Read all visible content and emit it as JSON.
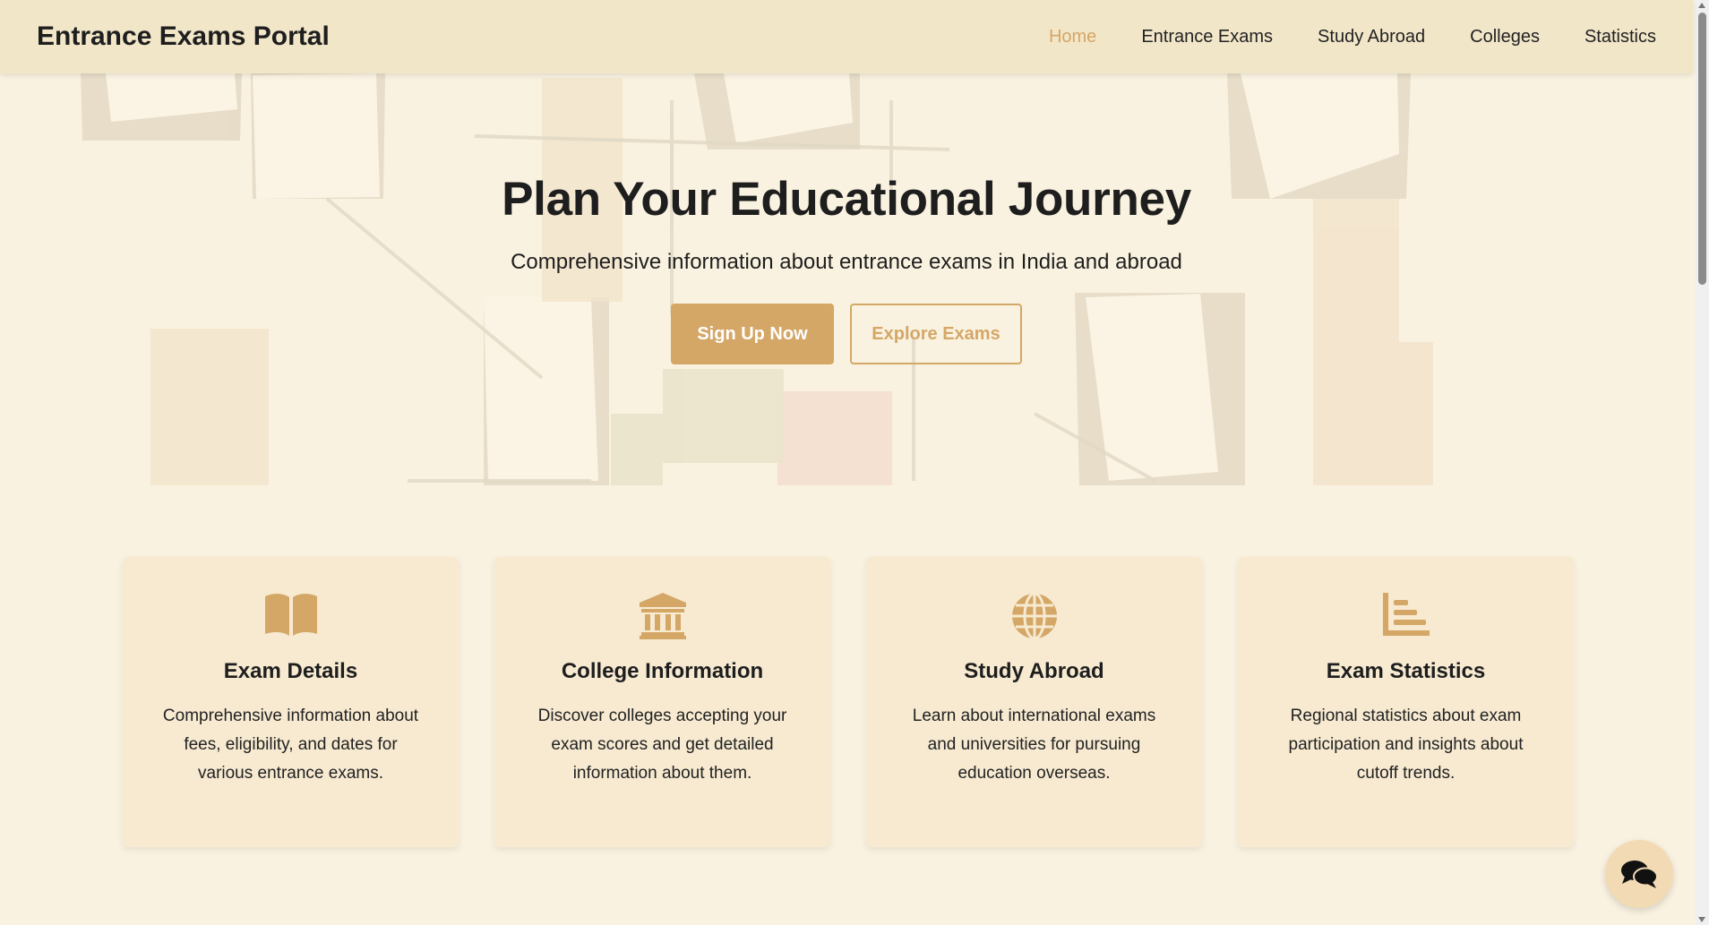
{
  "navbar": {
    "brand": "Entrance Exams Portal",
    "links": [
      {
        "label": "Home",
        "active": true
      },
      {
        "label": "Entrance Exams",
        "active": false
      },
      {
        "label": "Study Abroad",
        "active": false
      },
      {
        "label": "Colleges",
        "active": false
      },
      {
        "label": "Statistics",
        "active": false
      }
    ]
  },
  "hero": {
    "title": "Plan Your Educational Journey",
    "subtitle": "Comprehensive information about entrance exams in India and abroad",
    "primary_button": "Sign Up Now",
    "secondary_button": "Explore Exams"
  },
  "features": [
    {
      "icon": "book-icon",
      "title": "Exam Details",
      "description": "Comprehensive information about fees, eligibility, and dates for various entrance exams."
    },
    {
      "icon": "university-icon",
      "title": "College Information",
      "description": "Discover colleges accepting your exam scores and get detailed information about them."
    },
    {
      "icon": "globe-icon",
      "title": "Study Abroad",
      "description": "Learn about international exams and universities for pursuing education overseas."
    },
    {
      "icon": "chart-icon",
      "title": "Exam Statistics",
      "description": "Regional statistics about exam participation and insights about cutoff trends."
    }
  ],
  "chat": {
    "icon": "chat-icon"
  },
  "colors": {
    "accent": "#d4a767",
    "page_background": "#faf2e0",
    "navbar_background": "#f2e6c9",
    "card_background": "#f7ead1"
  }
}
